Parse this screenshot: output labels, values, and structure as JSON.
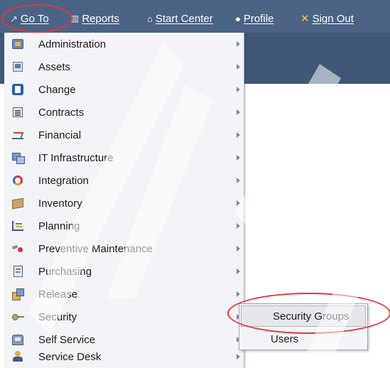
{
  "nav": {
    "goto": "Go To",
    "reports": "Reports",
    "start_center": "Start Center",
    "profile": "Profile",
    "sign_out": "Sign Out"
  },
  "menu": {
    "items": [
      {
        "label": "Administration",
        "icon": "administration-icon"
      },
      {
        "label": "Assets",
        "icon": "assets-icon"
      },
      {
        "label": "Change",
        "icon": "change-icon"
      },
      {
        "label": "Contracts",
        "icon": "contracts-icon"
      },
      {
        "label": "Financial",
        "icon": "financial-icon"
      },
      {
        "label": "IT Infrastructure",
        "icon": "it-infrastructure-icon"
      },
      {
        "label": "Integration",
        "icon": "integration-icon"
      },
      {
        "label": "Inventory",
        "icon": "inventory-icon"
      },
      {
        "label": "Planning",
        "icon": "planning-icon"
      },
      {
        "label": "Preventive Maintenance",
        "icon": "preventive-maintenance-icon"
      },
      {
        "label": "Purchasing",
        "icon": "purchasing-icon"
      },
      {
        "label": "Release",
        "icon": "release-icon"
      },
      {
        "label": "Security",
        "icon": "security-icon"
      },
      {
        "label": "Self Service",
        "icon": "self-service-icon"
      },
      {
        "label": "Service Desk",
        "icon": "service-desk-icon"
      }
    ]
  },
  "submenu": {
    "items": [
      {
        "label": "Security Groups"
      },
      {
        "label": "Users"
      }
    ],
    "active_index": 0
  },
  "colors": {
    "nav_bar": "#4a6385",
    "menu_bg": "#f3f4f7",
    "highlight_oval": "#e8333a"
  }
}
